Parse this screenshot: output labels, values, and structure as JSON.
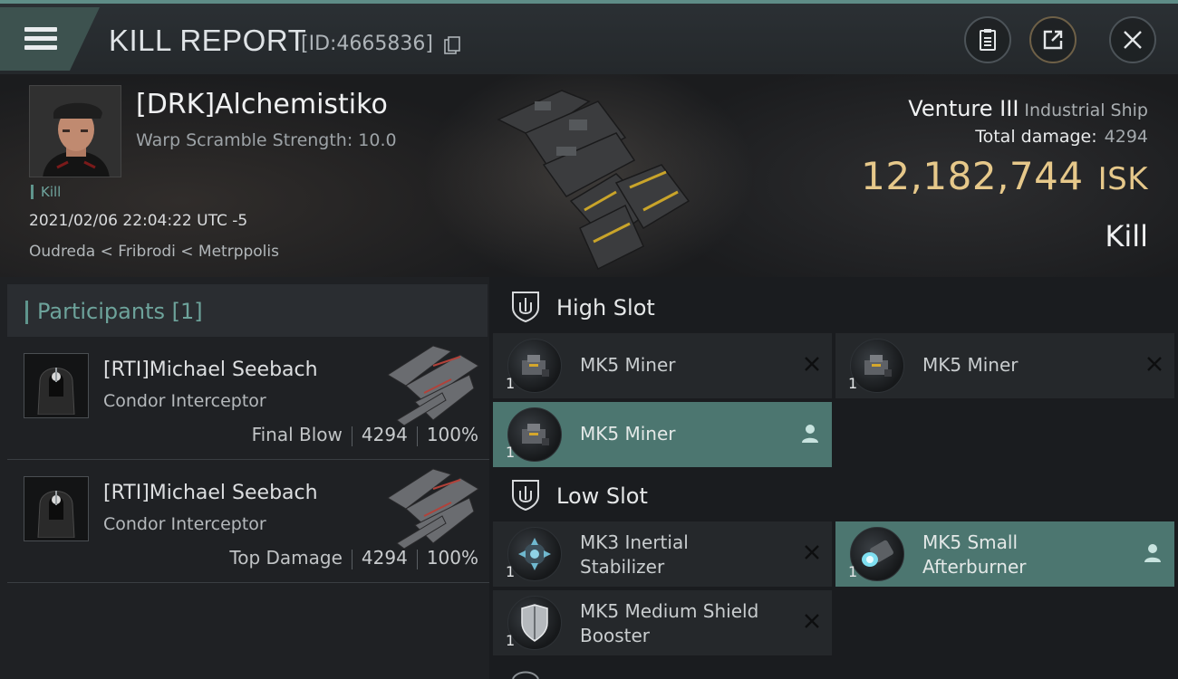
{
  "header": {
    "title": "KILL REPORT",
    "report_id": "[ID:4665836]",
    "icons": [
      "menu-icon",
      "copy-icon",
      "clipboard-icon",
      "share-icon",
      "close-icon"
    ]
  },
  "victim": {
    "name": "[DRK]Alchemistiko",
    "warp_scramble": "Warp Scramble Strength: 10.0",
    "tag": "Kill",
    "datetime": "2021/02/06 22:04:22 UTC -5",
    "location": "Oudreda < Fribrodi < Metrppolis",
    "ship_name": "Venture III",
    "ship_class": "Industrial Ship",
    "total_damage_label": "Total damage:",
    "total_damage_value": "4294",
    "isk_value": "12,182,744",
    "isk_unit": "ISK",
    "result": "Kill"
  },
  "participants": {
    "header": "Participants [1]",
    "rows": [
      {
        "name": "[RTI]Michael Seebach",
        "ship": "Condor Interceptor",
        "label": "Final Blow",
        "damage": "4294",
        "percent": "100%"
      },
      {
        "name": "[RTI]Michael Seebach",
        "ship": "Condor Interceptor",
        "label": "Top Damage",
        "damage": "4294",
        "percent": "100%"
      }
    ]
  },
  "slots": {
    "high": {
      "title": "High Slot",
      "items": [
        {
          "name": "MK5 Miner",
          "qty": "1",
          "state": "destroyed"
        },
        {
          "name": "MK5 Miner",
          "qty": "1",
          "state": "destroyed"
        },
        {
          "name": "MK5 Miner",
          "qty": "1",
          "state": "dropped"
        }
      ]
    },
    "low": {
      "title": "Low Slot",
      "items": [
        {
          "name_line1": "MK3 Inertial",
          "name_line2": "Stabilizer",
          "qty": "1",
          "state": "destroyed"
        },
        {
          "name_line1": "MK5 Small",
          "name_line2": "Afterburner",
          "qty": "1",
          "state": "dropped"
        },
        {
          "name_line1": "MK5 Medium Shield",
          "name_line2": "Booster",
          "qty": "1",
          "state": "destroyed"
        }
      ]
    }
  },
  "colors": {
    "accent": "#5f958d",
    "highlight": "#4c7670",
    "isk": "#e6c88a"
  }
}
